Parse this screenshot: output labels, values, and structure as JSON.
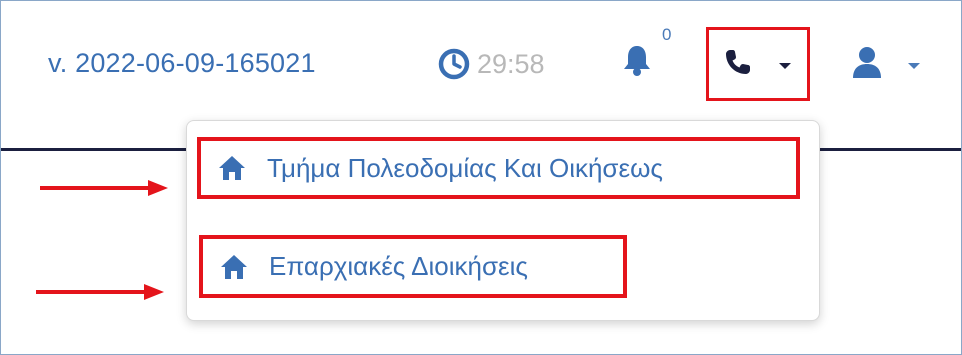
{
  "header": {
    "version": "v. 2022-06-09-165021",
    "timer": "29:58",
    "notifications_count": "0"
  },
  "icons": {
    "clock": "clock-icon",
    "bell": "bell-icon",
    "phone": "phone-icon",
    "user": "user-icon",
    "home": "home-icon",
    "caret": "caret-down-icon"
  },
  "dropdown": {
    "items": [
      {
        "label": "Τμήμα Πολεοδομίας Και Οικήσεως"
      },
      {
        "label": "Επαρχιακές Διοικήσεις"
      }
    ]
  },
  "colors": {
    "accent": "#3a6fb3",
    "highlight_border": "#e4141b",
    "header_rule": "#1b1f3f",
    "muted_text": "#b8b8b8"
  }
}
